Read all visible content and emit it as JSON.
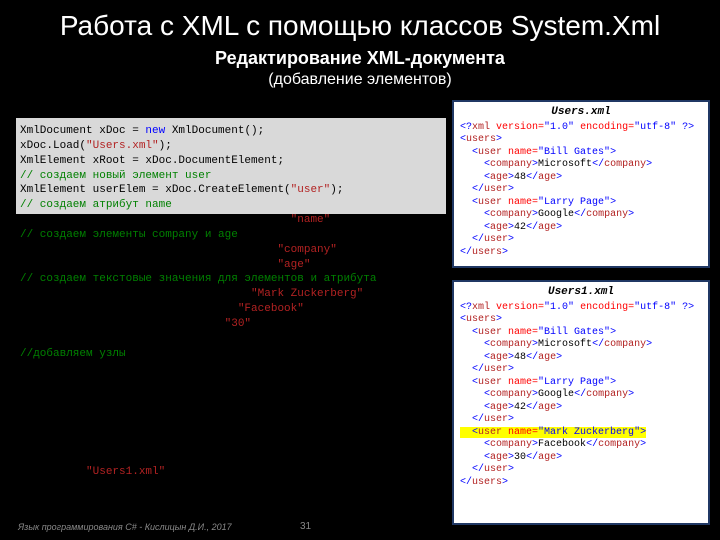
{
  "header": {
    "title": "Работа с XML с помощью классов System.Xml",
    "sub1": "Редактирование XML-документа",
    "sub2": "(добавление элементов)"
  },
  "code": {
    "l1a": "XmlDocument xDoc = ",
    "l1b": "new",
    "l1c": " XmlDocument();",
    "l2a": "xDoc.Load(",
    "l2b": "\"Users.xml\"",
    "l2c": ");",
    "l3": "XmlElement xRoot = xDoc.DocumentElement;",
    "l4": "// создаем новый элемент user",
    "l5a": "XmlElement userElem = xDoc.CreateElement(",
    "l5b": "\"user\"",
    "l5c": ");",
    "l6": "// создаем атрибут name",
    "l7": "                                         \"name\"",
    "l8": "// создаем элементы company и age",
    "l9": "                                       \"company\"",
    "l10": "                                       \"age\"",
    "l11": "// создаем текстовые значения для элементов и атрибута",
    "l12": "                                   \"Mark Zuckerberg\"",
    "l13": "                                 \"Facebook\"",
    "l14": "                               \"30\"",
    "l15": "",
    "l16": "//добавляем узлы",
    "l17": "",
    "l18": "",
    "l19": "",
    "l20": "",
    "l21": "",
    "l22": "",
    "l23": "",
    "l24a": "          ",
    "l24b": "\"Users1.xml\""
  },
  "xml1": {
    "title": "Users.xml",
    "r1a": "<?",
    "r1b": "xml",
    "r1c": " version=",
    "r1d": "\"1.0\"",
    "r1e": " encoding=",
    "r1f": "\"utf-8\"",
    "r1g": " ?>",
    "r2a": "<",
    "r2b": "users",
    "r2c": ">",
    "r3a": "  <",
    "r3b": "user",
    "r3c": " name=",
    "r3d": "\"Bill Gates\"",
    "r3e": ">",
    "r4a": "    <",
    "r4b": "company",
    "r4c": ">",
    "r4d": "Microsoft",
    "r4e": "</",
    "r4f": "company",
    "r4g": ">",
    "r5a": "    <",
    "r5b": "age",
    "r5c": ">",
    "r5d": "48",
    "r5e": "</",
    "r5f": "age",
    "r5g": ">",
    "r6a": "  </",
    "r6b": "user",
    "r6c": ">",
    "r7a": "  <",
    "r7b": "user",
    "r7c": " name=",
    "r7d": "\"Larry Page\"",
    "r7e": ">",
    "r8a": "    <",
    "r8b": "company",
    "r8c": ">",
    "r8d": "Google",
    "r8e": "</",
    "r8f": "company",
    "r8g": ">",
    "r9a": "    <",
    "r9b": "age",
    "r9c": ">",
    "r9d": "42",
    "r9e": "</",
    "r9f": "age",
    "r9g": ">",
    "r10a": "  </",
    "r10b": "user",
    "r10c": ">",
    "r11a": "</",
    "r11b": "users",
    "r11c": ">"
  },
  "xml2": {
    "title": "Users1.xml",
    "r1a": "<?",
    "r1b": "xml",
    "r1c": " version=",
    "r1d": "\"1.0\"",
    "r1e": " encoding=",
    "r1f": "\"utf-8\"",
    "r1g": " ?>",
    "r2a": "<",
    "r2b": "users",
    "r2c": ">",
    "r3a": "  <",
    "r3b": "user",
    "r3c": " name=",
    "r3d": "\"Bill Gates\"",
    "r3e": ">",
    "r4a": "    <",
    "r4b": "company",
    "r4c": ">",
    "r4d": "Microsoft",
    "r4e": "</",
    "r4f": "company",
    "r4g": ">",
    "r5a": "    <",
    "r5b": "age",
    "r5c": ">",
    "r5d": "48",
    "r5e": "</",
    "r5f": "age",
    "r5g": ">",
    "r6a": "  </",
    "r6b": "user",
    "r6c": ">",
    "r7a": "  <",
    "r7b": "user",
    "r7c": " name=",
    "r7d": "\"Larry Page\"",
    "r7e": ">",
    "r8a": "    <",
    "r8b": "company",
    "r8c": ">",
    "r8d": "Google",
    "r8e": "</",
    "r8f": "company",
    "r8g": ">",
    "r9a": "    <",
    "r9b": "age",
    "r9c": ">",
    "r9d": "42",
    "r9e": "</",
    "r9f": "age",
    "r9g": ">",
    "r10a": "  </",
    "r10b": "user",
    "r10c": ">",
    "h1a": "  <",
    "h1b": "user",
    "h1c": " name=",
    "h1d": "\"Mark Zuckerberg\"",
    "h1e": ">",
    "h2a": "    <",
    "h2b": "company",
    "h2c": ">",
    "h2d": "Facebook",
    "h2e": "</",
    "h2f": "company",
    "h2g": ">",
    "h3a": "    <",
    "h3b": "age",
    "h3c": ">",
    "h3d": "30",
    "h3e": "</",
    "h3f": "age",
    "h3g": ">",
    "h4a": "  </",
    "h4b": "user",
    "h4c": ">",
    "r11a": "</",
    "r11b": "users",
    "r11c": ">"
  },
  "footer": {
    "text": "Язык программирования C# - Кислицын Д.И., 2017",
    "page": "31"
  }
}
